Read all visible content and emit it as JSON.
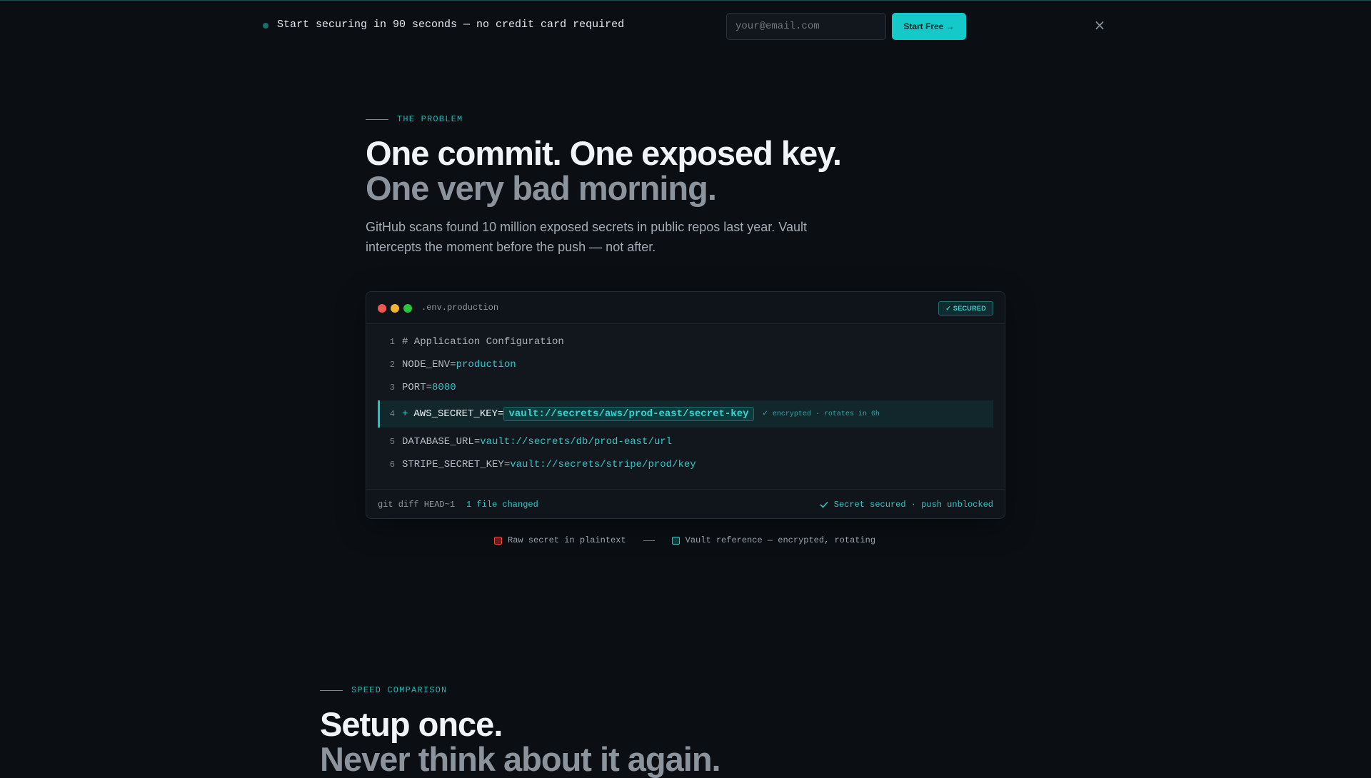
{
  "announcement": {
    "text": "Start securing in 90 seconds — no credit card required",
    "email_placeholder": "your@email.com",
    "cta_label": "Start Free →",
    "close_label": "×"
  },
  "problem": {
    "eyebrow": "THE PROBLEM",
    "heading_line1": "One commit. One exposed key.",
    "heading_line2": "One very bad morning.",
    "lead": "GitHub scans found 10 million exposed secrets in public repos last year. Vault intercepts the moment before the push — not after."
  },
  "code_window": {
    "filename": ".env.production",
    "badge": "✓ SECURED",
    "lines": [
      {
        "num": "1",
        "key": "# Application Configuration",
        "value": ""
      },
      {
        "num": "2",
        "key": "NODE_ENV=",
        "value": "production"
      },
      {
        "num": "3",
        "key": "PORT=",
        "value": "8080"
      },
      {
        "num": "4",
        "prefix": "+",
        "key": "AWS_SECRET_KEY=",
        "value": "vault://secrets/aws/prod-east/secret-key",
        "note": "✓ encrypted · rotates in 6h"
      },
      {
        "num": "5",
        "key": "DATABASE_URL=",
        "value": "vault://secrets/db/prod-east/url"
      },
      {
        "num": "6",
        "key": "STRIPE_SECRET_KEY=",
        "value": "vault://secrets/stripe/prod/key"
      }
    ],
    "footer_command": "git diff HEAD~1",
    "footer_changed": "1 file changed",
    "footer_status": "Secret secured · push unblocked"
  },
  "legend": {
    "raw": "Raw secret in plaintext",
    "vault": "Vault reference — encrypted, rotating"
  },
  "speed": {
    "eyebrow": "SPEED COMPARISON",
    "heading_line1": "Setup once.",
    "heading_line2": "Never think about it again."
  },
  "colors": {
    "accent": "#16c9c9",
    "background": "#0b0f14",
    "danger": "#e0473f"
  }
}
